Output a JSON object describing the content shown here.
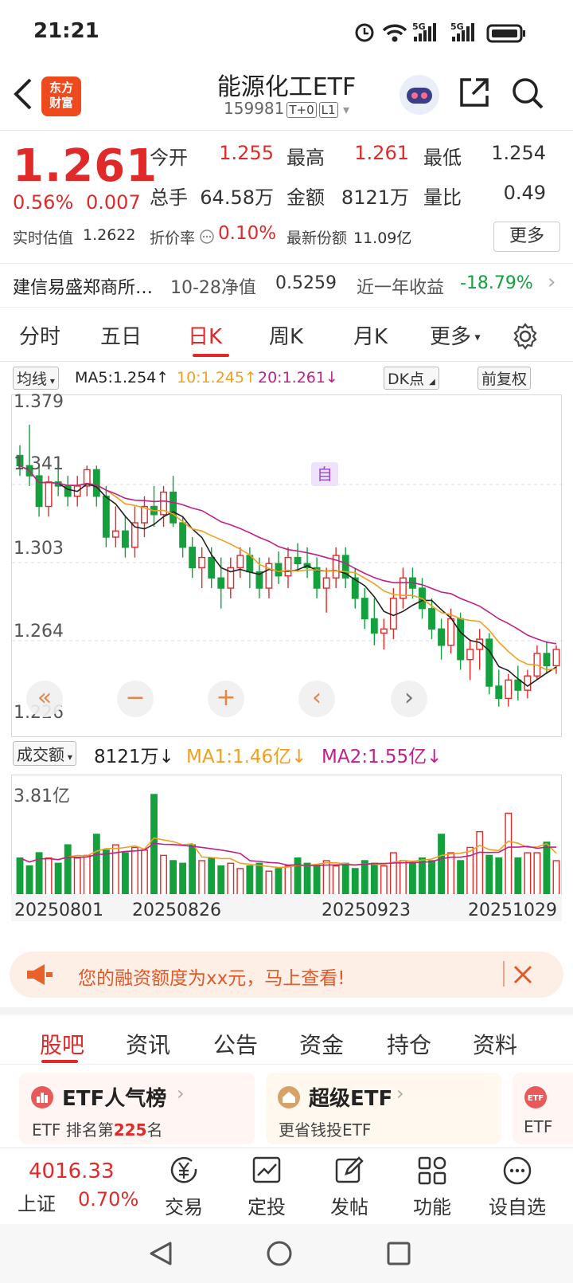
{
  "status": {
    "time": "21:21"
  },
  "header": {
    "title": "能源化工ETF",
    "code": "159981",
    "tag1": "T+0",
    "tag2": "L1",
    "logo": "东方\n财富",
    "logo_l1": "东方",
    "logo_l2": "财富"
  },
  "quote": {
    "price": "1.261",
    "pct": "0.56%",
    "chg": "0.007",
    "open_label": "今开",
    "open": "1.255",
    "high_label": "最高",
    "high": "1.261",
    "low_label": "最低",
    "low": "1.254",
    "vol_label": "总手",
    "vol": "64.58万",
    "amt_label": "金额",
    "amt": "8121万",
    "ratio_label": "量比",
    "ratio": "0.49",
    "iopv_label": "实时估值",
    "iopv": "1.2622",
    "prem_label": "折价率",
    "prem": "0.10%",
    "share_label": "最新份额",
    "share": "11.09亿",
    "more": "更多"
  },
  "fund": {
    "name": "建信易盛郑商所…",
    "nav_label": "10-28净值",
    "nav": "0.5259",
    "ret_label": "近一年收益",
    "ret": "-18.79%"
  },
  "tabs": [
    "分时",
    "五日",
    "日K",
    "周K",
    "月K",
    "更多"
  ],
  "ma": {
    "type": "均线",
    "ma5": "MA5:1.254↑",
    "ma10": "10:1.245↑",
    "ma20": "20:1.261↓",
    "dk": "DK点",
    "fq": "前复权"
  },
  "kline": {
    "y_labels": [
      "1.379",
      "1.341",
      "1.303",
      "1.264",
      "1.226"
    ],
    "marker": "自"
  },
  "volume": {
    "type": "成交额",
    "cur": "8121万↓",
    "ma1": "MA1:1.46亿↓",
    "ma2": "MA2:1.55亿↓",
    "ymax": "3.81亿"
  },
  "dates": [
    "20250801",
    "20250826",
    "20250923",
    "20251029"
  ],
  "banner": {
    "text": "您的融资额度为xx元，马上查看!"
  },
  "subtabs": [
    "股吧",
    "资讯",
    "公告",
    "资金",
    "持仓",
    "资料"
  ],
  "cards": [
    {
      "title": "ETF人气榜",
      "sub_pre": "ETF 排名第",
      "rank": "225",
      "sub_post": "名"
    },
    {
      "title": "超级ETF",
      "sub": "更省钱投ETF"
    },
    {
      "sub": "ETF"
    }
  ],
  "index": {
    "value": "4016.33",
    "name": "上证",
    "pct": "0.70%"
  },
  "bottom": [
    "交易",
    "定投",
    "发帖",
    "功能",
    "设自选"
  ],
  "colors": {
    "up": "#e02a2a",
    "down": "#14a03c",
    "ma5": "#222222",
    "ma10": "#f0a020",
    "ma20": "#c0208a"
  },
  "chart_data": {
    "type": "candlestick",
    "ylim": [
      1.226,
      1.379
    ],
    "ohlc": [
      [
        1.355,
        1.36,
        1.345,
        1.35
      ],
      [
        1.35,
        1.37,
        1.34,
        1.345
      ],
      [
        1.345,
        1.35,
        1.325,
        1.33
      ],
      [
        1.33,
        1.345,
        1.325,
        1.342
      ],
      [
        1.342,
        1.35,
        1.335,
        1.34
      ],
      [
        1.34,
        1.345,
        1.33,
        1.335
      ],
      [
        1.335,
        1.345,
        1.33,
        1.34
      ],
      [
        1.34,
        1.35,
        1.335,
        1.348
      ],
      [
        1.348,
        1.35,
        1.33,
        1.335
      ],
      [
        1.335,
        1.34,
        1.31,
        1.315
      ],
      [
        1.315,
        1.33,
        1.31,
        1.318
      ],
      [
        1.318,
        1.325,
        1.305,
        1.31
      ],
      [
        1.31,
        1.33,
        1.305,
        1.322
      ],
      [
        1.322,
        1.335,
        1.315,
        1.33
      ],
      [
        1.33,
        1.34,
        1.32,
        1.326
      ],
      [
        1.326,
        1.34,
        1.32,
        1.337
      ],
      [
        1.337,
        1.345,
        1.32,
        1.322
      ],
      [
        1.322,
        1.325,
        1.305,
        1.31
      ],
      [
        1.31,
        1.315,
        1.295,
        1.3
      ],
      [
        1.3,
        1.31,
        1.29,
        1.305
      ],
      [
        1.305,
        1.31,
        1.29,
        1.295
      ],
      [
        1.295,
        1.305,
        1.28,
        1.29
      ],
      [
        1.29,
        1.305,
        1.285,
        1.3
      ],
      [
        1.3,
        1.31,
        1.295,
        1.306
      ],
      [
        1.306,
        1.31,
        1.29,
        1.298
      ],
      [
        1.298,
        1.305,
        1.285,
        1.29
      ],
      [
        1.29,
        1.305,
        1.285,
        1.302
      ],
      [
        1.302,
        1.308,
        1.292,
        1.296
      ],
      [
        1.296,
        1.31,
        1.29,
        1.305
      ],
      [
        1.305,
        1.312,
        1.298,
        1.302
      ],
      [
        1.302,
        1.31,
        1.295,
        1.3
      ],
      [
        1.3,
        1.305,
        1.285,
        1.29
      ],
      [
        1.29,
        1.3,
        1.278,
        1.295
      ],
      [
        1.295,
        1.31,
        1.29,
        1.306
      ],
      [
        1.306,
        1.31,
        1.29,
        1.295
      ],
      [
        1.295,
        1.3,
        1.28,
        1.285
      ],
      [
        1.285,
        1.29,
        1.27,
        1.275
      ],
      [
        1.275,
        1.285,
        1.262,
        1.268
      ],
      [
        1.268,
        1.275,
        1.26,
        1.27
      ],
      [
        1.27,
        1.29,
        1.265,
        1.285
      ],
      [
        1.285,
        1.3,
        1.28,
        1.295
      ],
      [
        1.295,
        1.3,
        1.285,
        1.29
      ],
      [
        1.29,
        1.295,
        1.275,
        1.28
      ],
      [
        1.28,
        1.285,
        1.265,
        1.27
      ],
      [
        1.27,
        1.275,
        1.255,
        1.262
      ],
      [
        1.262,
        1.28,
        1.258,
        1.275
      ],
      [
        1.275,
        1.278,
        1.25,
        1.255
      ],
      [
        1.255,
        1.265,
        1.245,
        1.26
      ],
      [
        1.26,
        1.27,
        1.25,
        1.265
      ],
      [
        1.265,
        1.268,
        1.238,
        1.242
      ],
      [
        1.242,
        1.25,
        1.232,
        1.236
      ],
      [
        1.236,
        1.248,
        1.232,
        1.245
      ],
      [
        1.245,
        1.252,
        1.235,
        1.24
      ],
      [
        1.24,
        1.25,
        1.236,
        1.247
      ],
      [
        1.247,
        1.262,
        1.245,
        1.258
      ],
      [
        1.258,
        1.264,
        1.248,
        1.252
      ],
      [
        1.252,
        1.262,
        1.248,
        1.26
      ]
    ],
    "volumes": [
      1.4,
      1.1,
      1.6,
      1.4,
      1.2,
      1.9,
      1.4,
      1.5,
      2.3,
      1.7,
      1.9,
      1.6,
      1.8,
      1.7,
      3.81,
      1.5,
      1.3,
      1.2,
      1.9,
      1.3,
      1.4,
      1.1,
      1.2,
      1.0,
      1.1,
      1.2,
      0.9,
      1.0,
      1.1,
      1.4,
      1.2,
      1.1,
      1.3,
      1.1,
      1.2,
      1.0,
      1.3,
      1.2,
      1.1,
      1.6,
      1.3,
      1.2,
      1.4,
      1.3,
      2.3,
      1.6,
      1.3,
      1.8,
      2.4,
      1.5,
      1.4,
      3.1,
      1.4,
      1.6,
      1.6,
      2.0,
      1.3
    ]
  }
}
